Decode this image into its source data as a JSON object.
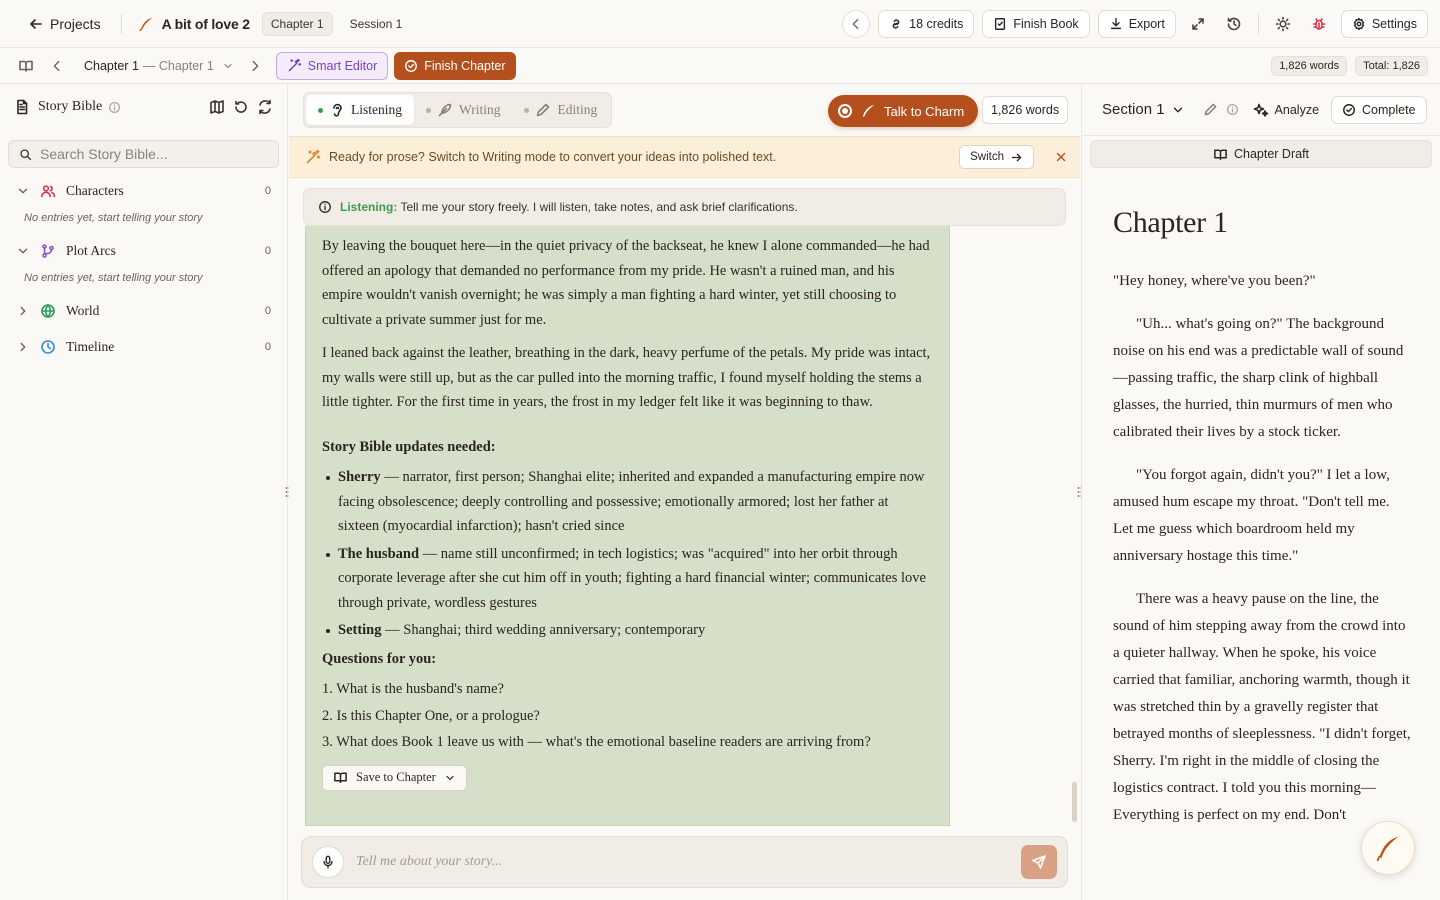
{
  "topbar": {
    "back_label": "Projects",
    "book_title": "A bit of love 2",
    "chapter_chip": "Chapter 1",
    "session_chip": "Session 1",
    "credits": "18 credits",
    "finish_book": "Finish Book",
    "export": "Export",
    "settings": "Settings"
  },
  "subbar": {
    "chapter_main": "Chapter 1",
    "chapter_sub": "— Chapter 1",
    "smart_editor": "Smart Editor",
    "finish_chapter": "Finish Chapter",
    "words": "1,826 words",
    "total": "Total: 1,826"
  },
  "sidebar": {
    "title": "Story Bible",
    "search_placeholder": "Search Story Bible...",
    "sections": [
      {
        "name": "Characters",
        "count": "0",
        "empty": "No entries yet, start telling your story"
      },
      {
        "name": "Plot Arcs",
        "count": "0",
        "empty": "No entries yet, start telling your story"
      },
      {
        "name": "World",
        "count": "0"
      },
      {
        "name": "Timeline",
        "count": "0"
      }
    ]
  },
  "main": {
    "modes": [
      "Listening",
      "Writing",
      "Editing"
    ],
    "talk_button": "Talk to Charm",
    "word_count": "1,826 words",
    "banner_text": "Ready for prose? Switch to Writing mode to convert your ideas into polished text.",
    "banner_switch": "Switch",
    "listen_label": "Listening:",
    "listen_text": "Tell me your story freely. I will listen, take notes, and ask brief clarifications.",
    "message": {
      "p1": "By leaving the bouquet here—in the quiet privacy of the backseat, he knew I alone commanded—he had offered an apology that demanded no performance from my pride. He wasn't a ruined man, and his empire wouldn't vanish overnight; he was simply a man fighting a hard winter, yet still choosing to cultivate a private summer just for me.",
      "p2": "I leaned back against the leather, breathing in the dark, heavy perfume of the petals. My pride was intact, my walls were still up, but as the car pulled into the morning traffic, I found myself holding the stems a little tighter. For the first time in years, the frost in my ledger felt like it was beginning to thaw.",
      "updates_heading": "Story Bible updates needed:",
      "updates": [
        {
          "name": "Sherry",
          "text": " — narrator, first person; Shanghai elite; inherited and expanded a manufacturing empire now facing obsolescence; deeply controlling and possessive; emotionally armored; lost her father at sixteen (myocardial infarction); hasn't cried since"
        },
        {
          "name": "The husband",
          "text": " — name still unconfirmed; in tech logistics; was \"acquired\" into her orbit through corporate leverage after she cut him off in youth; fighting a hard financial winter; communicates love through private, wordless gestures"
        },
        {
          "name": "Setting",
          "text": " — Shanghai; third wedding anniversary; contemporary"
        }
      ],
      "questions_heading": "Questions for you:",
      "questions": [
        "1. What is the husband's name?",
        "2. Is this Chapter One, or a prologue?",
        "3. What does Book 1 leave us with — what's the emotional baseline readers are arriving from?"
      ],
      "save_button": "Save to Chapter"
    },
    "composer_placeholder": "Tell me about your story..."
  },
  "right": {
    "section": "Section 1",
    "analyze": "Analyze",
    "complete": "Complete",
    "draft_tab": "Chapter Draft",
    "chapter_title": "Chapter 1",
    "paragraphs": [
      "\"Hey honey, where've you been?\"",
      "\"Uh... what's going on?\" The background noise on his end was a predictable wall of sound—passing traffic, the sharp clink of highball glasses, the hurried, thin murmurs of men who calibrated their lives by a stock ticker.",
      "\"You forgot again, didn't you?\" I let a low, amused hum escape my throat. \"Don't tell me. Let me guess which boardroom held my anniversary hostage this time.\"",
      "There was a heavy pause on the line, the sound of him stepping away from the crowd into a quieter hallway. When he spoke, his voice carried that familiar, anchoring warmth, though it was stretched thin by a gravelly register that betrayed months of sleeplessness. \"I didn't forget, Sherry. I'm right in the middle of closing the logistics contract. I told you this morning—Everything is perfect on my end. Don't"
    ]
  },
  "colors": {
    "accent": "#b4501e",
    "listening_green": "#3d9b4f",
    "smart_editor_purple": "#7b3fc4",
    "message_bg": "#d6dfc8",
    "banner_bg": "#fcefd9"
  }
}
